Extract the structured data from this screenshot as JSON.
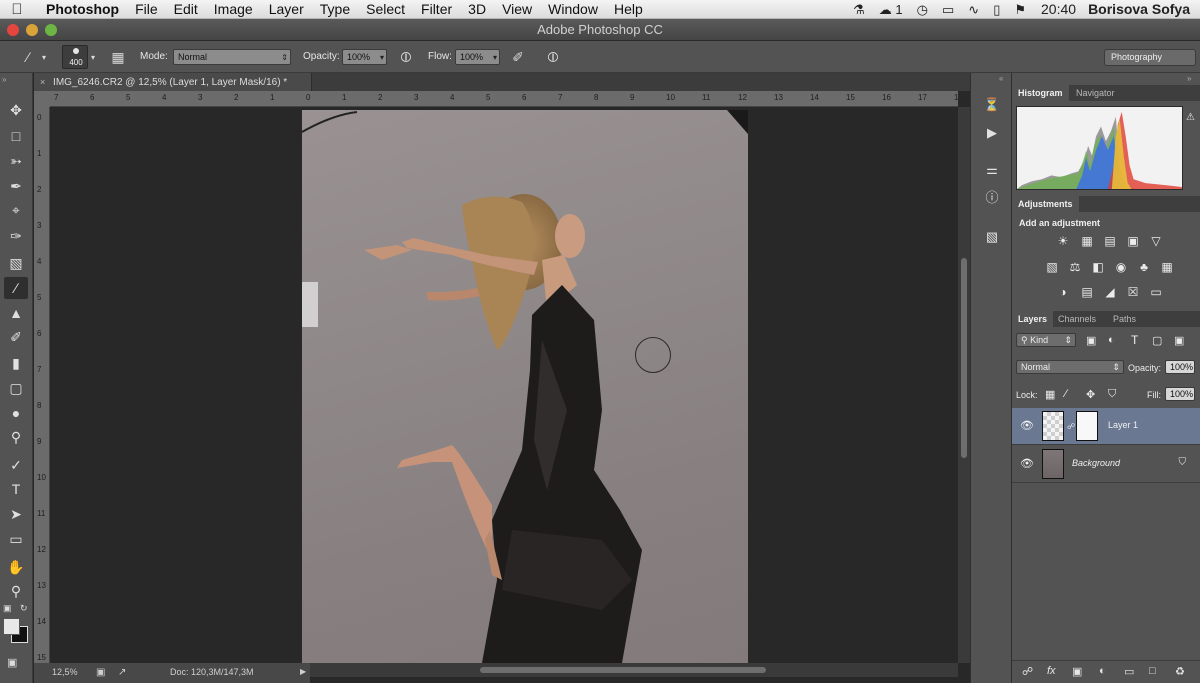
{
  "menubar": {
    "apple": "",
    "items": [
      "Photoshop",
      "File",
      "Edit",
      "Image",
      "Layer",
      "Type",
      "Select",
      "Filter",
      "3D",
      "View",
      "Window",
      "Help"
    ],
    "tray_badge": "1",
    "clock": "20:40",
    "user": "Borisova Sofya"
  },
  "window": {
    "title": "Adobe Photoshop CC"
  },
  "options": {
    "brush_size": "400",
    "mode_label": "Mode:",
    "mode_value": "Normal",
    "opacity_label": "Opacity:",
    "opacity_value": "100%",
    "flow_label": "Flow:",
    "flow_value": "100%",
    "workspace": "Photography"
  },
  "document": {
    "tab_title": "IMG_6246.CR2 @ 12,5% (Layer 1, Layer Mask/16) *",
    "zoom": "12,5%",
    "doc_info": "Doc: 120,3M/147,3M",
    "ruler_top": [
      "7",
      "6",
      "5",
      "4",
      "3",
      "2",
      "1",
      "0",
      "1",
      "2",
      "3",
      "4",
      "5",
      "6",
      "7",
      "8",
      "9",
      "10",
      "11",
      "12",
      "13",
      "14",
      "15",
      "16",
      "17",
      "18"
    ],
    "ruler_left": [
      "0",
      "1",
      "2",
      "3",
      "4",
      "5",
      "6",
      "7",
      "8",
      "9",
      "10",
      "11",
      "12",
      "13",
      "14",
      "15"
    ]
  },
  "panels": {
    "histogram_tab": "Histogram",
    "navigator_tab": "Navigator",
    "adjustments_tab": "Adjustments",
    "add_adjustment": "Add an adjustment",
    "layers_tab": "Layers",
    "channels_tab": "Channels",
    "paths_tab": "Paths",
    "kind_filter": "Kind",
    "blend_mode": "Normal",
    "opacity_label": "Opacity:",
    "opacity_value": "100%",
    "lock_label": "Lock:",
    "fill_label": "Fill:",
    "fill_value": "100%",
    "layers": [
      {
        "name": "Layer 1",
        "selected": true
      },
      {
        "name": "Background",
        "selected": false
      }
    ]
  },
  "colors": {
    "accent_selected_layer": "#6b7891",
    "panel_bg": "#535353",
    "canvas_bg": "#282828"
  }
}
